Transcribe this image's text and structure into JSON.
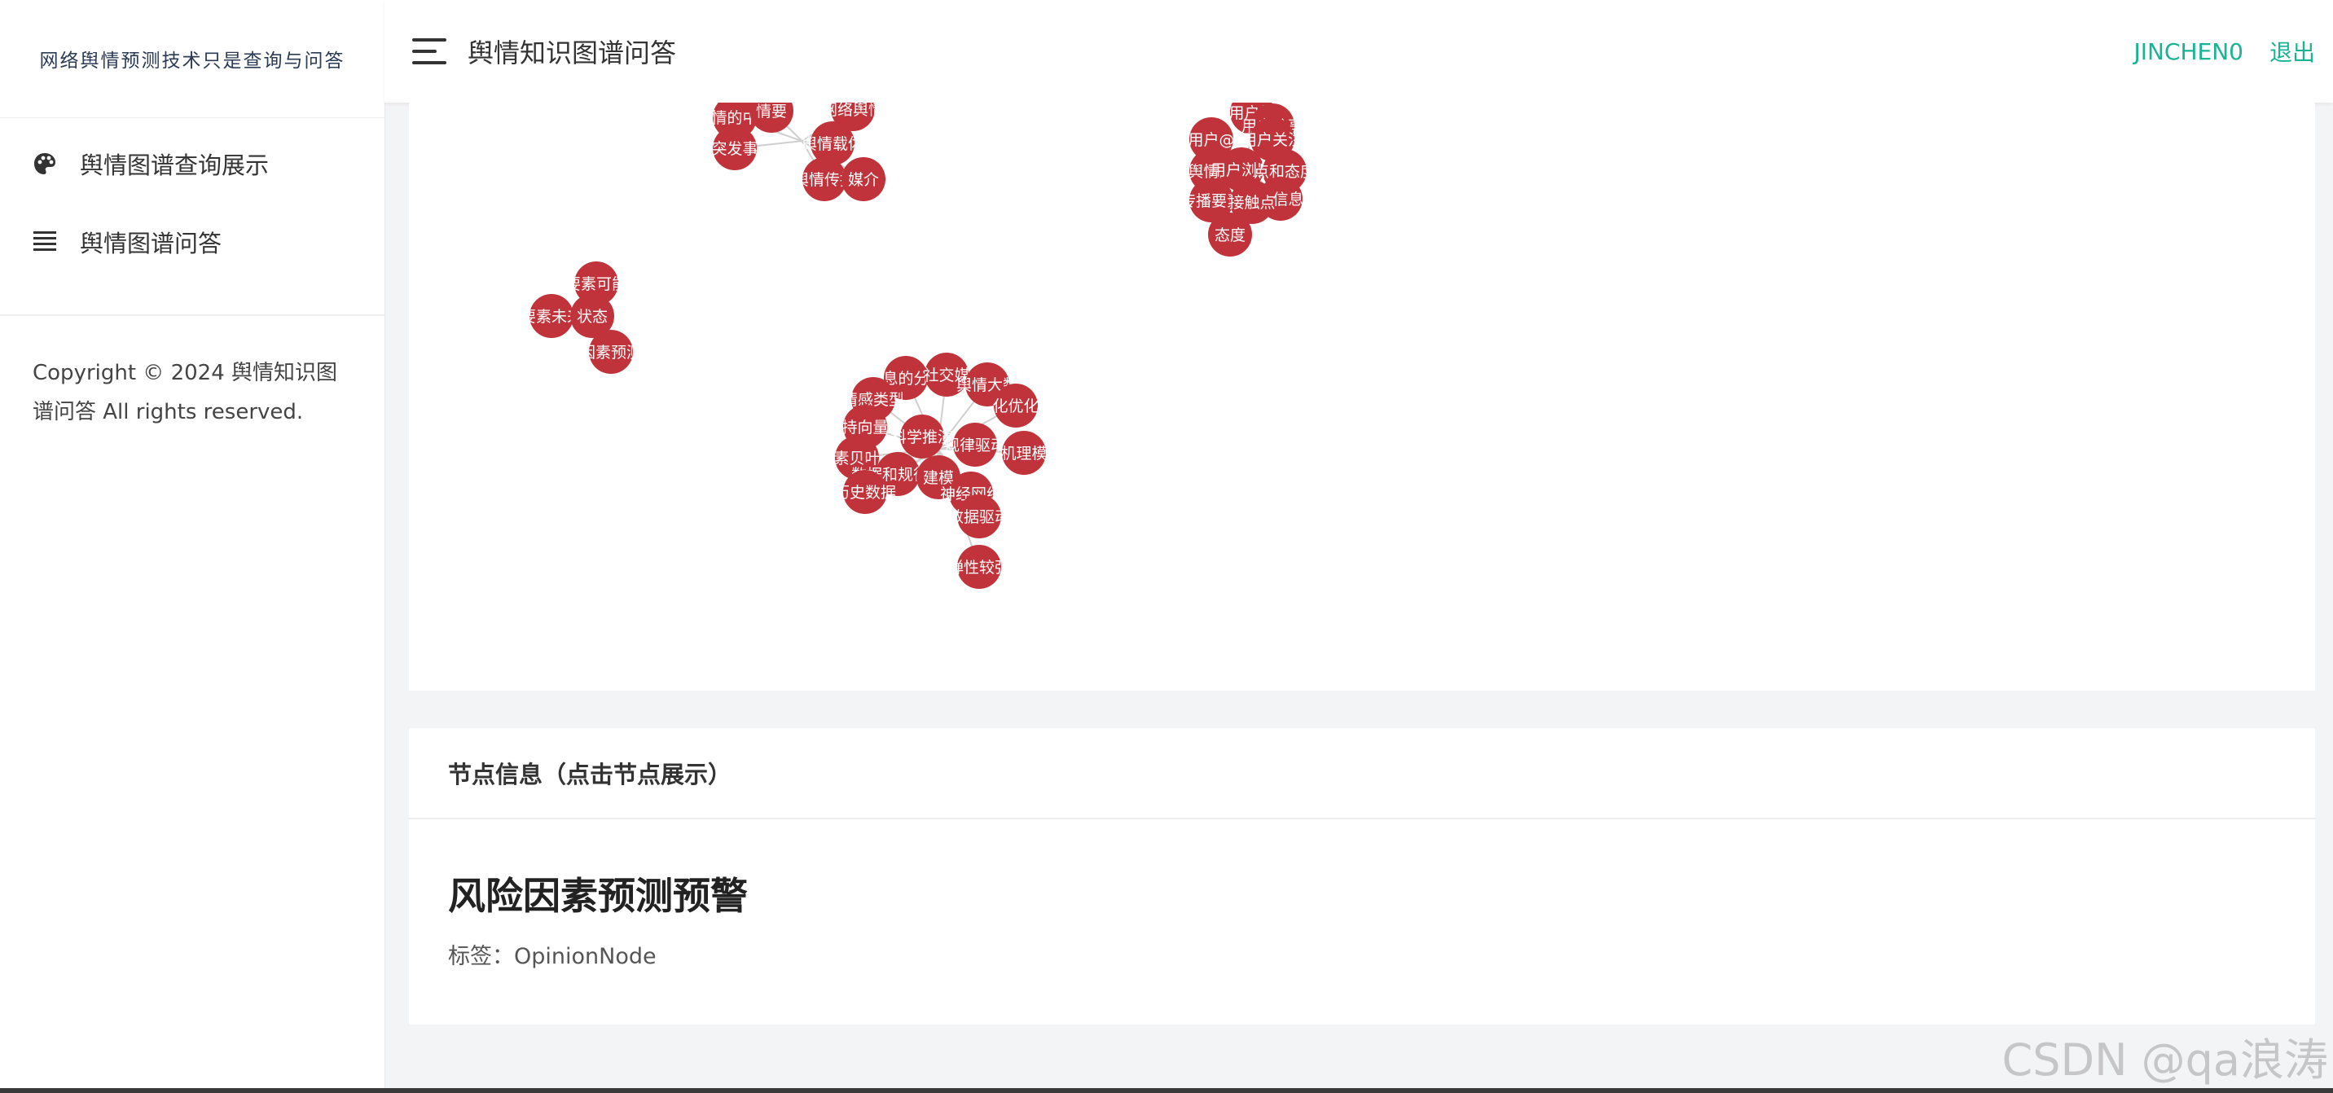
{
  "brand": "网络舆情预测技术只是查询与问答",
  "sidebar": {
    "items": [
      {
        "label": "舆情图谱查询展示",
        "icon": "palette-icon"
      },
      {
        "label": "舆情图谱问答",
        "icon": "list-icon"
      }
    ],
    "copyright_line1": "Copyright © 2024 舆情知识图",
    "copyright_line2": "谱问答 All rights reserved."
  },
  "header": {
    "title": "舆情知识图谱问答",
    "user": "JINCHEN0",
    "logout": "退出"
  },
  "graph": {
    "node_color": "#c0333a",
    "clusters": [
      {
        "nodes": [
          {
            "label": "舆情的中介"
          },
          {
            "label": "情要"
          },
          {
            "label": "网络舆情"
          },
          {
            "label": "突发事"
          },
          {
            "label": "舆情载体"
          },
          {
            "label": "舆情传播"
          },
          {
            "label": "媒介"
          }
        ]
      },
      {
        "nodes": [
          {
            "label": "用户转"
          },
          {
            "label": "用户分享"
          },
          {
            "label": "用户@"
          },
          {
            "label": "用户关注"
          },
          {
            "label": "舆情的"
          },
          {
            "label": "用户浏览"
          },
          {
            "label": "点和态度"
          },
          {
            "label": "传播要素"
          },
          {
            "label": "为信息"
          },
          {
            "label": "接触点"
          },
          {
            "label": "态度"
          }
        ]
      },
      {
        "nodes": [
          {
            "label": "要素可能"
          },
          {
            "label": "要素未来"
          },
          {
            "label": "状态"
          },
          {
            "label": "因素预测"
          }
        ]
      },
      {
        "nodes": [
          {
            "label": "信息的分析"
          },
          {
            "label": "社交媒"
          },
          {
            "label": "舆情大数"
          },
          {
            "label": "情感类型"
          },
          {
            "label": "化优化"
          },
          {
            "label": "持向量"
          },
          {
            "label": "科学推演"
          },
          {
            "label": "规律驱动"
          },
          {
            "label": "机理模"
          },
          {
            "label": "素贝叶"
          },
          {
            "label": "数据和规律，"
          },
          {
            "label": "建模"
          },
          {
            "label": "神经网络"
          },
          {
            "label": "历史数据"
          },
          {
            "label": "数据驱动"
          },
          {
            "label": "弹性较强"
          }
        ]
      }
    ]
  },
  "info": {
    "header": "节点信息（点击节点展示）",
    "title": "风险因素预测预警",
    "label_line": "标签：OpinionNode"
  },
  "watermark": "CSDN @qa浪涛"
}
